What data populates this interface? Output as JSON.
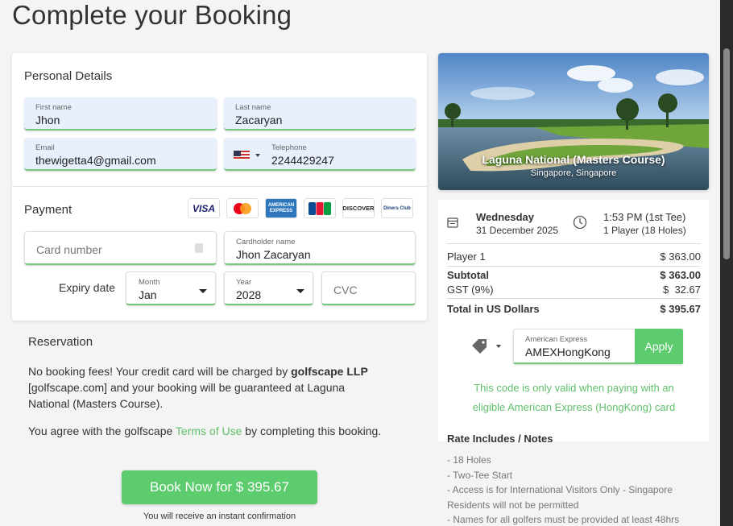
{
  "page": {
    "title": "Complete your Booking"
  },
  "personal": {
    "section_label": "Personal Details",
    "first_name": {
      "label": "First name",
      "value": "Jhon"
    },
    "last_name": {
      "label": "Last name",
      "value": "Zacaryan"
    },
    "email": {
      "label": "Email",
      "value": "thewigetta4@gmail.com"
    },
    "phone": {
      "label": "Telephone",
      "value": "2244429247",
      "country_icon": "us-flag-icon"
    }
  },
  "payment": {
    "section_label": "Payment",
    "cards": [
      "VISA",
      "mastercard",
      "AMERICAN EXPRESS",
      "JCB",
      "DISCOVER",
      "Diners Club"
    ],
    "card_number": {
      "placeholder": "Card number"
    },
    "cardholder": {
      "label": "Cardholder name",
      "value": "Jhon Zacaryan"
    },
    "expiry_label": "Expiry date",
    "month": {
      "label": "Month",
      "value": "Jan"
    },
    "year": {
      "label": "Year",
      "value": "2028"
    },
    "cvc": {
      "placeholder": "CVC"
    }
  },
  "reservation": {
    "title": "Reservation",
    "p1_before": "No booking fees! Your credit card will be charged by ",
    "p1_bold": "golfscape LLP",
    "p1_after": " [golfscape.com] and your booking will be guaranteed at Laguna National (Masters Course).",
    "p2_before": "You agree with the golfscape ",
    "p2_link": "Terms of Use",
    "p2_after": " by completing this booking.",
    "book_button": "Book Now for $ 395.67",
    "confirm_note": "You will receive an instant confirmation"
  },
  "course": {
    "name": "Laguna National (Masters Course)",
    "location": "Singapore, Singapore"
  },
  "summary": {
    "day": "Wednesday",
    "date": "31 December 2025",
    "time": "1:53 PM (1st Tee)",
    "players": "1 Player (18 Holes)",
    "rows": [
      {
        "label": "Player 1",
        "value": "$ 363.00"
      },
      {
        "label": "Subtotal",
        "value": "$ 363.00"
      },
      {
        "label": "GST (9%)",
        "value": "$  32.67"
      },
      {
        "label": "Total in US Dollars",
        "value": "$ 395.67"
      }
    ]
  },
  "promo": {
    "label": "American Express",
    "value": "AMEXHongKong",
    "apply": "Apply",
    "note": "This code is only valid when paying with an eligible American Express (HongKong) card"
  },
  "rates": {
    "title": "Rate Includes / Notes",
    "items": [
      "- 18 Holes",
      "- Two-Tee Start",
      "- Access is for International Visitors Only - Singapore Residents will not be permitted",
      "- Names for all golfers must be provided at least 48hrs"
    ]
  },
  "colors": {
    "accent": "#5dcc6e",
    "field_bg": "#e8effd"
  }
}
